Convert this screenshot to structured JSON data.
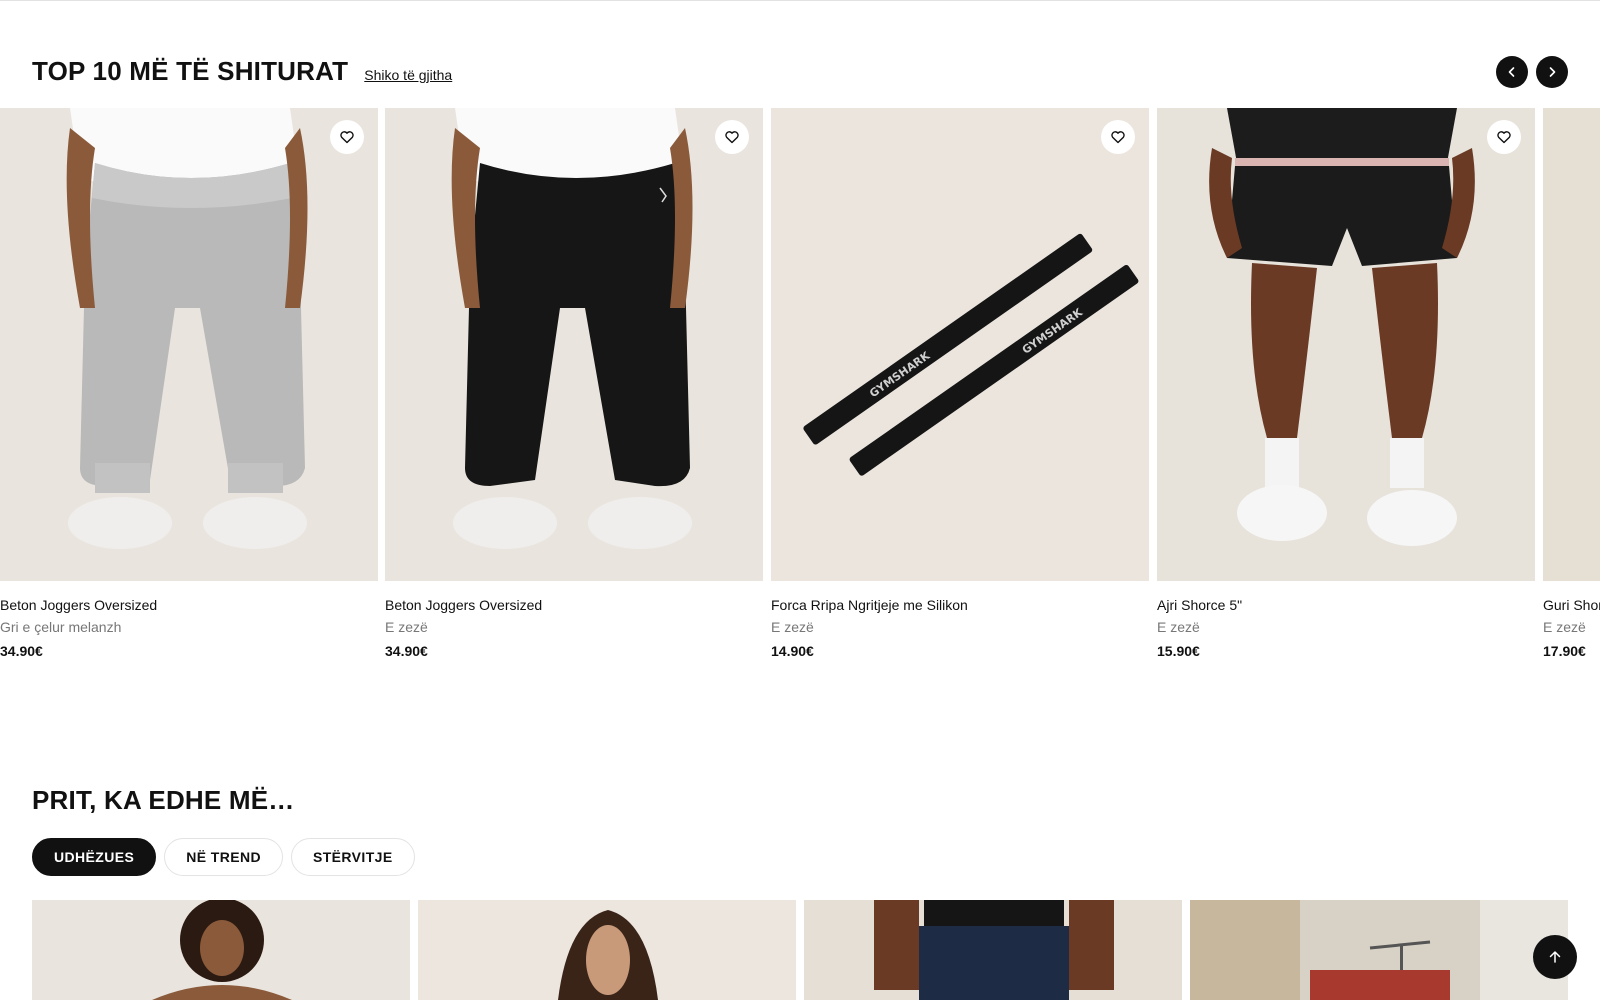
{
  "section_top": {
    "title": "TOP 10 MË TË SHITURAT",
    "see_all": "Shiko të gjitha",
    "prev_icon": "chevron-left-icon",
    "next_icon": "chevron-right-icon",
    "wishlist_icon": "heart-icon",
    "products": [
      {
        "name": "Beton Joggers Oversized",
        "color": "Gri e çelur melanzh",
        "price": "34.90€"
      },
      {
        "name": "Beton Joggers Oversized",
        "color": "E zezë",
        "price": "34.90€"
      },
      {
        "name": "Forca Rripa Ngritjeje me Silikon",
        "color": "E zezë",
        "price": "14.90€"
      },
      {
        "name": "Ajri Shorce 5\"",
        "color": "E zezë",
        "price": "15.90€"
      },
      {
        "name": "Guri Shor",
        "color": "E zezë",
        "price": "17.90€"
      }
    ],
    "strap_logo": "GYMSHARK"
  },
  "section_more": {
    "title": "PRIT, KA EDHE MË…",
    "tabs": [
      {
        "label": "UDHËZUES",
        "active": true
      },
      {
        "label": "NË TREND",
        "active": false
      },
      {
        "label": "STËRVITJE",
        "active": false
      }
    ]
  },
  "back_to_top_icon": "arrow-up-icon",
  "colors": {
    "accent": "#111111",
    "muted_text": "#777777",
    "image_bg": "#e8e2da"
  }
}
